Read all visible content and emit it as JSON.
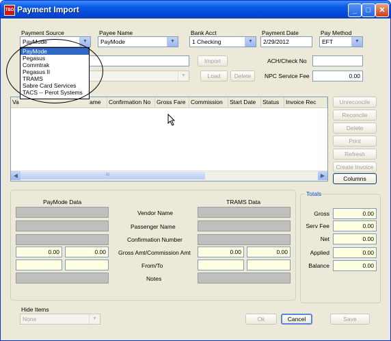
{
  "window": {
    "title": "Payment Import",
    "app_icon": "TBO"
  },
  "top": {
    "payment_source": {
      "label": "Payment Source",
      "value": "PayMode"
    },
    "payee_name": {
      "label": "Payee Name",
      "value": "PayMode"
    },
    "bank_acct": {
      "label": "Bank Acct",
      "value": "1 Checking"
    },
    "payment_date": {
      "label": "Payment Date",
      "value": "2/29/2012"
    },
    "pay_method": {
      "label": "Pay Method",
      "value": "EFT"
    },
    "import_label": "Import",
    "load_label": "Load",
    "delete_label": "Delete",
    "ach_label": "ACH/Check No",
    "ach_value": "",
    "npc_label": "NPC Service Fee",
    "npc_value": "0.00"
  },
  "dropdown": {
    "items": [
      "PayMode",
      "Pegasus",
      "Commtrak",
      "Pegasus II",
      "TRAMS",
      "Sabre Card Services",
      "TACS -- Perot Systems"
    ],
    "selected": "PayMode"
  },
  "list": {
    "columns": [
      "Va",
      "ame",
      "Confirmation No",
      "Gross Fare",
      "Commission",
      "Start Date",
      "Status",
      "Invoice Rec"
    ],
    "scroll_glyph": "III"
  },
  "side_buttons": {
    "unreconcile": "Unreconcile",
    "reconcile": "Reconcile",
    "delete": "Delete",
    "print": "Print",
    "refresh": "Refresh",
    "create_invoice": "Create Invoice",
    "columns": "Columns"
  },
  "detail": {
    "paymode_title": "PayMode Data",
    "trams_title": "TRAMS Data",
    "labels": [
      "Vendor Name",
      "Passenger Name",
      "Confirmation Number",
      "Gross Amt/Commission Amt",
      "From/To",
      "Notes"
    ],
    "paymode_gross": "0.00",
    "paymode_comm": "0.00",
    "trams_gross": "0.00",
    "trams_comm": "0.00"
  },
  "totals": {
    "title": "Totals",
    "gross_label": "Gross",
    "gross": "0.00",
    "serv_fee_label": "Serv Fee",
    "serv_fee": "0.00",
    "net_label": "Net",
    "net": "0.00",
    "applied_label": "Applied",
    "applied": "0.00",
    "balance_label": "Balance",
    "balance": "0.00"
  },
  "bottom": {
    "hide_items_label": "Hide Items",
    "hide_items_value": "None",
    "ok_label": "Ok",
    "cancel_label": "Cancel",
    "save_label": "Save"
  }
}
